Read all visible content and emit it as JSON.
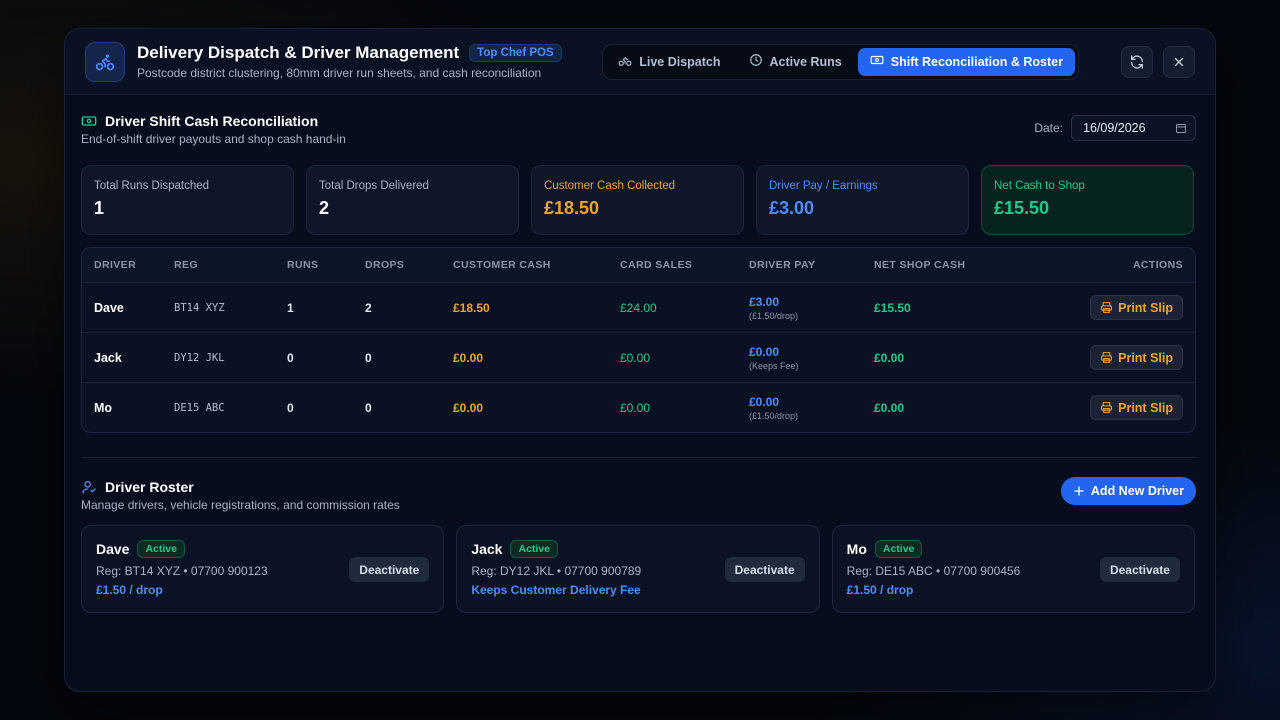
{
  "header": {
    "title": "Delivery Dispatch & Driver Management",
    "badge": "Top Chef POS",
    "subtitle": "Postcode district clustering, 80mm driver run sheets, and cash reconciliation",
    "tabs": [
      {
        "label": "Live Dispatch",
        "icon": "bike-icon"
      },
      {
        "label": "Active Runs",
        "icon": "clock-icon"
      },
      {
        "label": "Shift Reconciliation & Roster",
        "icon": "cash-icon",
        "active": true
      }
    ]
  },
  "reconciliation": {
    "title": "Driver Shift Cash Reconciliation",
    "subtitle": "End-of-shift driver payouts and shop cash hand-in",
    "date_label": "Date:",
    "date_value": "16/09/2026",
    "stats": [
      {
        "label": "Total Runs Dispatched",
        "value": "1"
      },
      {
        "label": "Total Drops Delivered",
        "value": "2"
      },
      {
        "label": "Customer Cash Collected",
        "value": "£18.50"
      },
      {
        "label": "Driver Pay / Earnings",
        "value": "£3.00"
      },
      {
        "label": "Net Cash to Shop",
        "value": "£15.50"
      }
    ],
    "columns": [
      "DRIVER",
      "REG",
      "RUNS",
      "DROPS",
      "CUSTOMER CASH",
      "CARD SALES",
      "DRIVER PAY",
      "NET SHOP CASH",
      "ACTIONS"
    ],
    "rows": [
      {
        "driver": "Dave",
        "reg": "BT14 XYZ",
        "runs": "1",
        "drops": "2",
        "cash": "£18.50",
        "card": "£24.00",
        "pay": "£3.00",
        "pay_note": "(£1.50/drop)",
        "net": "£15.50",
        "action": "Print Slip"
      },
      {
        "driver": "Jack",
        "reg": "DY12 JKL",
        "runs": "0",
        "drops": "0",
        "cash": "£0.00",
        "card": "£0.00",
        "pay": "£0.00",
        "pay_note": "(Keeps Fee)",
        "net": "£0.00",
        "action": "Print Slip"
      },
      {
        "driver": "Mo",
        "reg": "DE15 ABC",
        "runs": "0",
        "drops": "0",
        "cash": "£0.00",
        "card": "£0.00",
        "pay": "£0.00",
        "pay_note": "(£1.50/drop)",
        "net": "£0.00",
        "action": "Print Slip"
      }
    ]
  },
  "roster": {
    "title": "Driver Roster",
    "subtitle": "Manage drivers, vehicle registrations, and commission rates",
    "add_label": "Add New Driver",
    "drivers": [
      {
        "name": "Dave",
        "status": "Active",
        "info": "Reg: BT14 XYZ • 07700 900123",
        "rate": "£1.50 / drop",
        "action": "Deactivate"
      },
      {
        "name": "Jack",
        "status": "Active",
        "info": "Reg: DY12 JKL • 07700 900789",
        "rate": "Keeps Customer Delivery Fee",
        "action": "Deactivate"
      },
      {
        "name": "Mo",
        "status": "Active",
        "info": "Reg: DE15 ABC • 07700 900456",
        "rate": "£1.50 / drop",
        "action": "Deactivate"
      }
    ]
  },
  "colors": {
    "accent": "#2465f0",
    "cash": "#f0a52a",
    "pay": "#4d8dff",
    "net": "#1ecb8b"
  }
}
